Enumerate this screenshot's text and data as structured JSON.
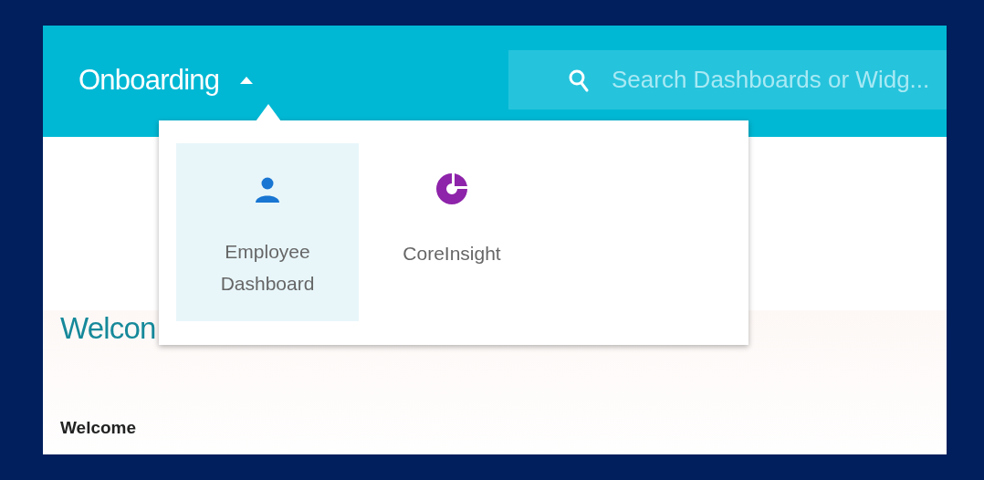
{
  "header": {
    "title": "Onboarding",
    "menu_expanded": true
  },
  "search": {
    "placeholder": "Search Dashboards or Widg..."
  },
  "dashboard_menu": {
    "items": [
      {
        "label": "Employee Dashboard",
        "kind": "person",
        "selected": true
      },
      {
        "label": "CoreInsight",
        "kind": "insight",
        "selected": false
      }
    ]
  },
  "content": {
    "heading": "Welcon",
    "section_title": "Welcome"
  }
}
